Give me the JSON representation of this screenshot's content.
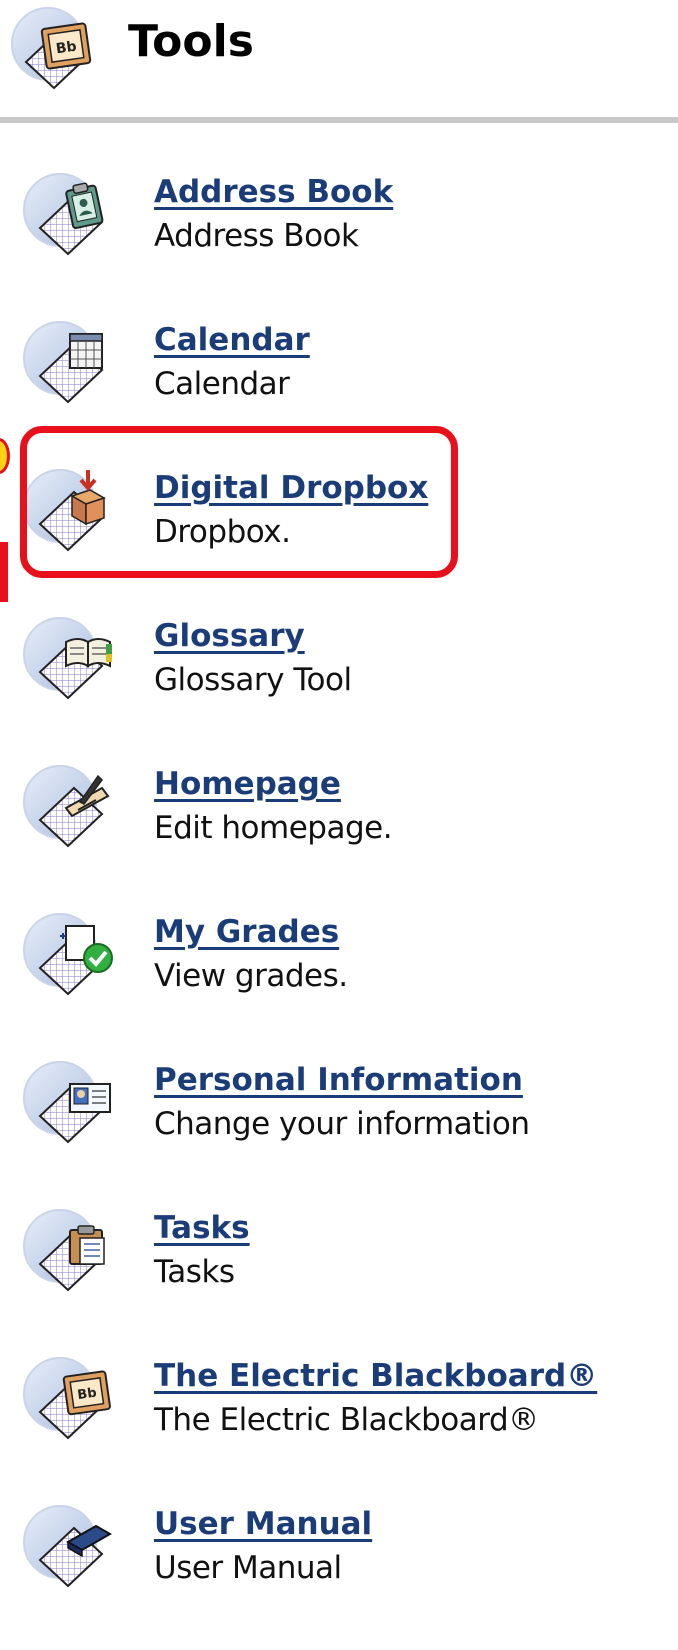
{
  "header": {
    "title": "Tools",
    "icon": "blackboard-bb-icon"
  },
  "tools": [
    {
      "label": "Address Book",
      "description": "Address Book",
      "icon": "address-book-icon"
    },
    {
      "label": "Calendar",
      "description": "Calendar",
      "icon": "calendar-icon"
    },
    {
      "label": "Digital Dropbox",
      "description": "Dropbox.",
      "icon": "dropbox-icon",
      "highlighted": true
    },
    {
      "label": "Glossary",
      "description": "Glossary Tool",
      "icon": "glossary-book-icon"
    },
    {
      "label": "Homepage",
      "description": "Edit homepage.",
      "icon": "homepage-edit-icon"
    },
    {
      "label": "My Grades",
      "description": "View grades.",
      "icon": "grades-check-icon"
    },
    {
      "label": "Personal Information",
      "description": "Change your information",
      "icon": "personal-info-card-icon"
    },
    {
      "label": "Tasks",
      "description": "Tasks",
      "icon": "tasks-clipboard-icon"
    },
    {
      "label": "The Electric Blackboard®",
      "description": "The Electric Blackboard®",
      "icon": "electric-blackboard-icon"
    },
    {
      "label": "User Manual",
      "description": "User Manual",
      "icon": "user-manual-book-icon"
    }
  ],
  "colors": {
    "link": "#1a3c78",
    "highlight": "#e8101a",
    "divider": "#c8c8c8"
  }
}
